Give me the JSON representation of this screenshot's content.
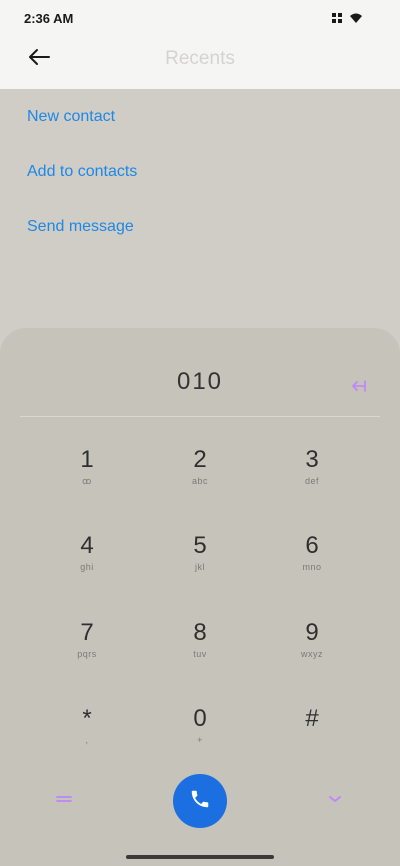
{
  "status": {
    "time": "2:36 AM",
    "icons": [
      "grid-icon",
      "wifi-icon",
      "battery-icon"
    ]
  },
  "header": {
    "title": "Recents",
    "back_icon": "arrow-left-icon"
  },
  "actions": [
    {
      "label": "New contact"
    },
    {
      "label": "Add to contacts"
    },
    {
      "label": "Send message"
    }
  ],
  "dialpad": {
    "entry": "010",
    "backspace_icon": "backspace-icon",
    "keys": [
      {
        "num": "1",
        "sub": "ꝏ"
      },
      {
        "num": "2",
        "sub": "abc"
      },
      {
        "num": "3",
        "sub": "def"
      },
      {
        "num": "4",
        "sub": "ghi"
      },
      {
        "num": "5",
        "sub": "jkl"
      },
      {
        "num": "6",
        "sub": "mno"
      },
      {
        "num": "7",
        "sub": "pqrs"
      },
      {
        "num": "8",
        "sub": "tuv"
      },
      {
        "num": "9",
        "sub": "wxyz"
      },
      {
        "num": "*",
        "sub": ","
      },
      {
        "num": "0",
        "sub": "+"
      },
      {
        "num": "#",
        "sub": ""
      }
    ],
    "left_icon": "menu-icon",
    "call_icon": "phone-icon",
    "right_icon": "chevron-down-icon"
  },
  "colors": {
    "accent": "#1e88e5",
    "call_button": "#1b6fe0",
    "pad_icon": "#c084fc"
  }
}
